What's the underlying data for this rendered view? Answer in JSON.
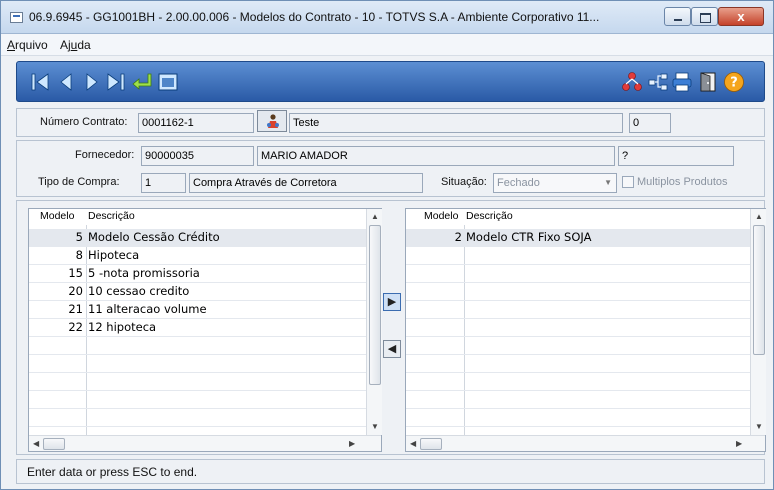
{
  "window": {
    "title": "06.9.6945 - GG1001BH - 2.00.00.006 - Modelos do Contrato - 10 - TOTVS S.A - Ambiente Corporativo 11...",
    "close_glyph": "x"
  },
  "menu": {
    "arquivo_pre": "A",
    "arquivo_rest": "rquivo",
    "ajuda_pre": "Aj",
    "ajuda_u": "u",
    "ajuda_rest": "da"
  },
  "toolbar": {
    "nav_icons": [
      "first-record-icon",
      "previous-record-icon",
      "next-record-icon",
      "last-record-icon",
      "return-icon",
      "window-icon"
    ],
    "right_icons": [
      "relationship-icon",
      "flow-icon",
      "print-icon",
      "exit-door-icon",
      "help-icon"
    ]
  },
  "contract": {
    "numero_label": "Número Contrato:",
    "numero_value": "0001162-1",
    "descricao_value": "Teste",
    "count_value": "0"
  },
  "supplier": {
    "fornecedor_label": "Fornecedor:",
    "fornecedor_code": "90000035",
    "fornecedor_name": "MARIO AMADOR",
    "extra_value": "?",
    "tipo_label": "Tipo de Compra:",
    "tipo_code": "1",
    "tipo_desc": "Compra Através de Corretora",
    "situacao_label": "Situação:",
    "situacao_value": "Fechado",
    "multiplos_label": "Multiplos Produtos"
  },
  "left_grid": {
    "col_modelo": "Modelo",
    "col_descricao": "Descrição",
    "rows": [
      {
        "modelo": "5",
        "descricao": "Modelo Cessão Crédito"
      },
      {
        "modelo": "8",
        "descricao": "Hipoteca"
      },
      {
        "modelo": "15",
        "descricao": "5 -nota promissoria"
      },
      {
        "modelo": "20",
        "descricao": "10 cessao credito"
      },
      {
        "modelo": "21",
        "descricao": "11 alteracao volume"
      },
      {
        "modelo": "22",
        "descricao": "12 hipoteca"
      }
    ]
  },
  "right_grid": {
    "col_modelo": "Modelo",
    "col_descricao": "Descrição",
    "rows": [
      {
        "modelo": "2",
        "descricao": "Modelo CTR Fixo SOJA"
      }
    ]
  },
  "move": {
    "add_glyph": "▶",
    "remove_glyph": "◀"
  },
  "status": {
    "text": "Enter data or press ESC to end."
  },
  "colors": {
    "toolbar": "#2a5aa6",
    "selected_row": "#e4e8ee",
    "close_button": "#c5422a"
  }
}
